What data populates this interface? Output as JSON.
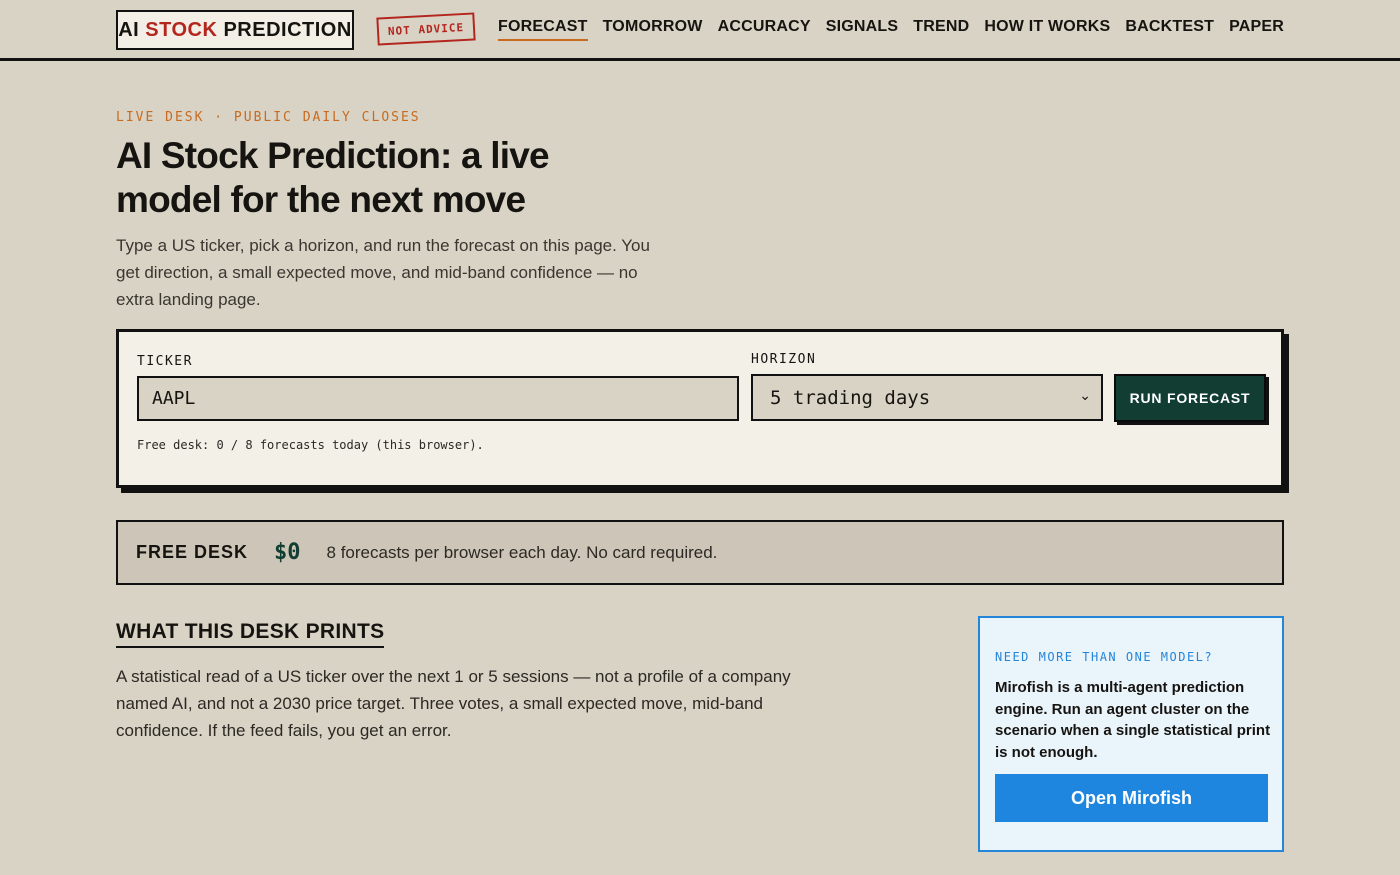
{
  "header": {
    "logo_prefix": "AI",
    "logo_accent": "STOCK",
    "logo_suffix": "PREDICTION",
    "stamp": "NOT ADVICE",
    "nav": [
      {
        "label": "FORECAST",
        "active": true
      },
      {
        "label": "TOMORROW"
      },
      {
        "label": "ACCURACY"
      },
      {
        "label": "SIGNALS"
      },
      {
        "label": "TREND"
      },
      {
        "label": "HOW IT WORKS"
      },
      {
        "label": "BACKTEST"
      },
      {
        "label": "PAPER"
      }
    ]
  },
  "hero": {
    "eyebrow": "LIVE DESK · PUBLIC DAILY CLOSES",
    "title": "AI Stock Prediction: a live model for the next move",
    "lead": "Type a US ticker, pick a horizon, and run the forecast on this page. You get direction, a small expected move, and mid-band confidence — no extra landing page."
  },
  "forecast": {
    "ticker_label": "TICKER",
    "ticker_value": "AAPL",
    "horizon_label": "HORIZON",
    "horizon_value": "5 trading days",
    "run_label": "RUN FORECAST",
    "quota_text": "Free desk: 0 / 8 forecasts today (this browser)."
  },
  "free_desk": {
    "label": "FREE DESK",
    "price": "$0",
    "text": "8 forecasts per browser each day. No card required."
  },
  "prints": {
    "title": "WHAT THIS DESK PRINTS",
    "body": "A statistical read of a US ticker over the next 1 or 5 sessions — not a profile of a company named AI, and not a 2030 price target. Three votes, a small expected move, mid-band confidence. If the feed fails, you get an error."
  },
  "mirofish": {
    "eyebrow": "NEED MORE THAN ONE MODEL?",
    "text": "Mirofish is a multi-agent prediction engine. Run an agent cluster on the scenario when a single statistical print is not enough.",
    "button": "Open Mirofish"
  },
  "colors": {
    "background": "#d9d3c6",
    "accent_red": "#b3261e",
    "accent_orange": "#c86b1e",
    "run_button": "#123d32",
    "mirofish_blue": "#1e86df"
  },
  "icons": {
    "horizon_dropdown": "chevron-down-icon"
  }
}
